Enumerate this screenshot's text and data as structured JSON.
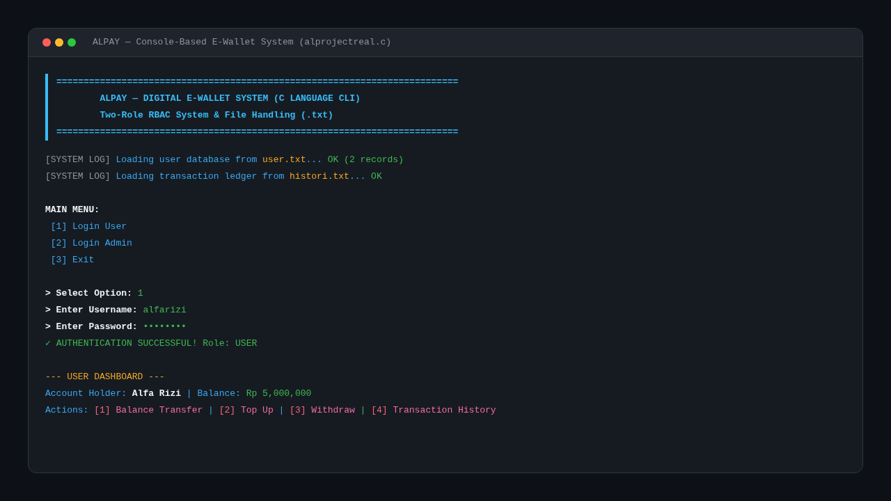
{
  "window": {
    "title": "ALPAY — Console-Based E-Wallet System (alprojectreal.c)"
  },
  "banner": [
    "==========================================================================",
    "        ALPAY — DIGITAL E-WALLET SYSTEM (C LANGUAGE CLI)",
    "        Two-Role RBAC System & File Handling (.txt)",
    "=========================================================================="
  ],
  "lines": [
    {
      "kind": "text",
      "segments": [
        {
          "text": "[SYSTEM LOG] ",
          "kind": "muted"
        },
        {
          "text": "Loading user database from ",
          "kind": "info"
        },
        {
          "text": "user.txt",
          "kind": "file"
        },
        {
          "text": "... ",
          "kind": "info"
        },
        {
          "text": "OK (2 records)",
          "kind": "ok"
        }
      ]
    },
    {
      "kind": "text",
      "segments": [
        {
          "text": "[SYSTEM LOG] ",
          "kind": "muted"
        },
        {
          "text": "Loading transaction ledger from ",
          "kind": "info"
        },
        {
          "text": "histori.txt",
          "kind": "file"
        },
        {
          "text": "... ",
          "kind": "info"
        },
        {
          "text": "OK",
          "kind": "ok"
        }
      ]
    },
    {
      "kind": "gap"
    },
    {
      "kind": "text",
      "segments": [
        {
          "text": "**MAIN MENU:**",
          "kind": "plain"
        }
      ]
    },
    {
      "kind": "text",
      "segments": [
        {
          "text": " [1] Login User",
          "kind": "info"
        }
      ]
    },
    {
      "kind": "text",
      "segments": [
        {
          "text": " [2] Login Admin",
          "kind": "info"
        }
      ]
    },
    {
      "kind": "text",
      "segments": [
        {
          "text": " [3] Exit",
          "kind": "info"
        }
      ]
    },
    {
      "kind": "gap"
    },
    {
      "kind": "text",
      "segments": [
        {
          "text": "**> Select Option:** ",
          "kind": "plain"
        },
        {
          "text": "1",
          "kind": "ok"
        }
      ]
    },
    {
      "kind": "text",
      "segments": [
        {
          "text": "**> Enter Username:** ",
          "kind": "plain"
        },
        {
          "text": "alfarizi",
          "kind": "ok"
        }
      ]
    },
    {
      "kind": "text",
      "segments": [
        {
          "text": "**> Enter Password:** ",
          "kind": "plain"
        },
        {
          "text": "••••••••",
          "kind": "ok"
        }
      ]
    },
    {
      "kind": "text",
      "segments": [
        {
          "text": "✓ AUTHENTICATION SUCCESSFUL! Role: USER",
          "kind": "ok"
        }
      ]
    },
    {
      "kind": "gap"
    },
    {
      "kind": "text",
      "segments": [
        {
          "text": "--- USER DASHBOARD ---",
          "kind": "file"
        }
      ]
    },
    {
      "kind": "text",
      "segments": [
        {
          "text": "Account Holder: ",
          "kind": "info"
        },
        {
          "text": "**Alfa Rizi**",
          "kind": "plain"
        },
        {
          "text": " | Balance: ",
          "kind": "info"
        },
        {
          "text": "Rp 5,000,000",
          "kind": "ok"
        }
      ]
    },
    {
      "kind": "text",
      "segments": [
        {
          "text": "Actions: ",
          "kind": "info"
        },
        {
          "text": "[1] ",
          "kind": "key"
        },
        {
          "text": "Balance Transfer",
          "kind": "action"
        },
        {
          "text": " | ",
          "kind": "info"
        },
        {
          "text": "[2] ",
          "kind": "key"
        },
        {
          "text": "Top Up",
          "kind": "action"
        },
        {
          "text": " | ",
          "kind": "info"
        },
        {
          "text": "[3] ",
          "kind": "key"
        },
        {
          "text": "Withdraw",
          "kind": "action"
        },
        {
          "text": " | ",
          "kind": "ok"
        },
        {
          "text": "[4] ",
          "kind": "key"
        },
        {
          "text": "Transaction History",
          "kind": "action"
        }
      ]
    }
  ]
}
